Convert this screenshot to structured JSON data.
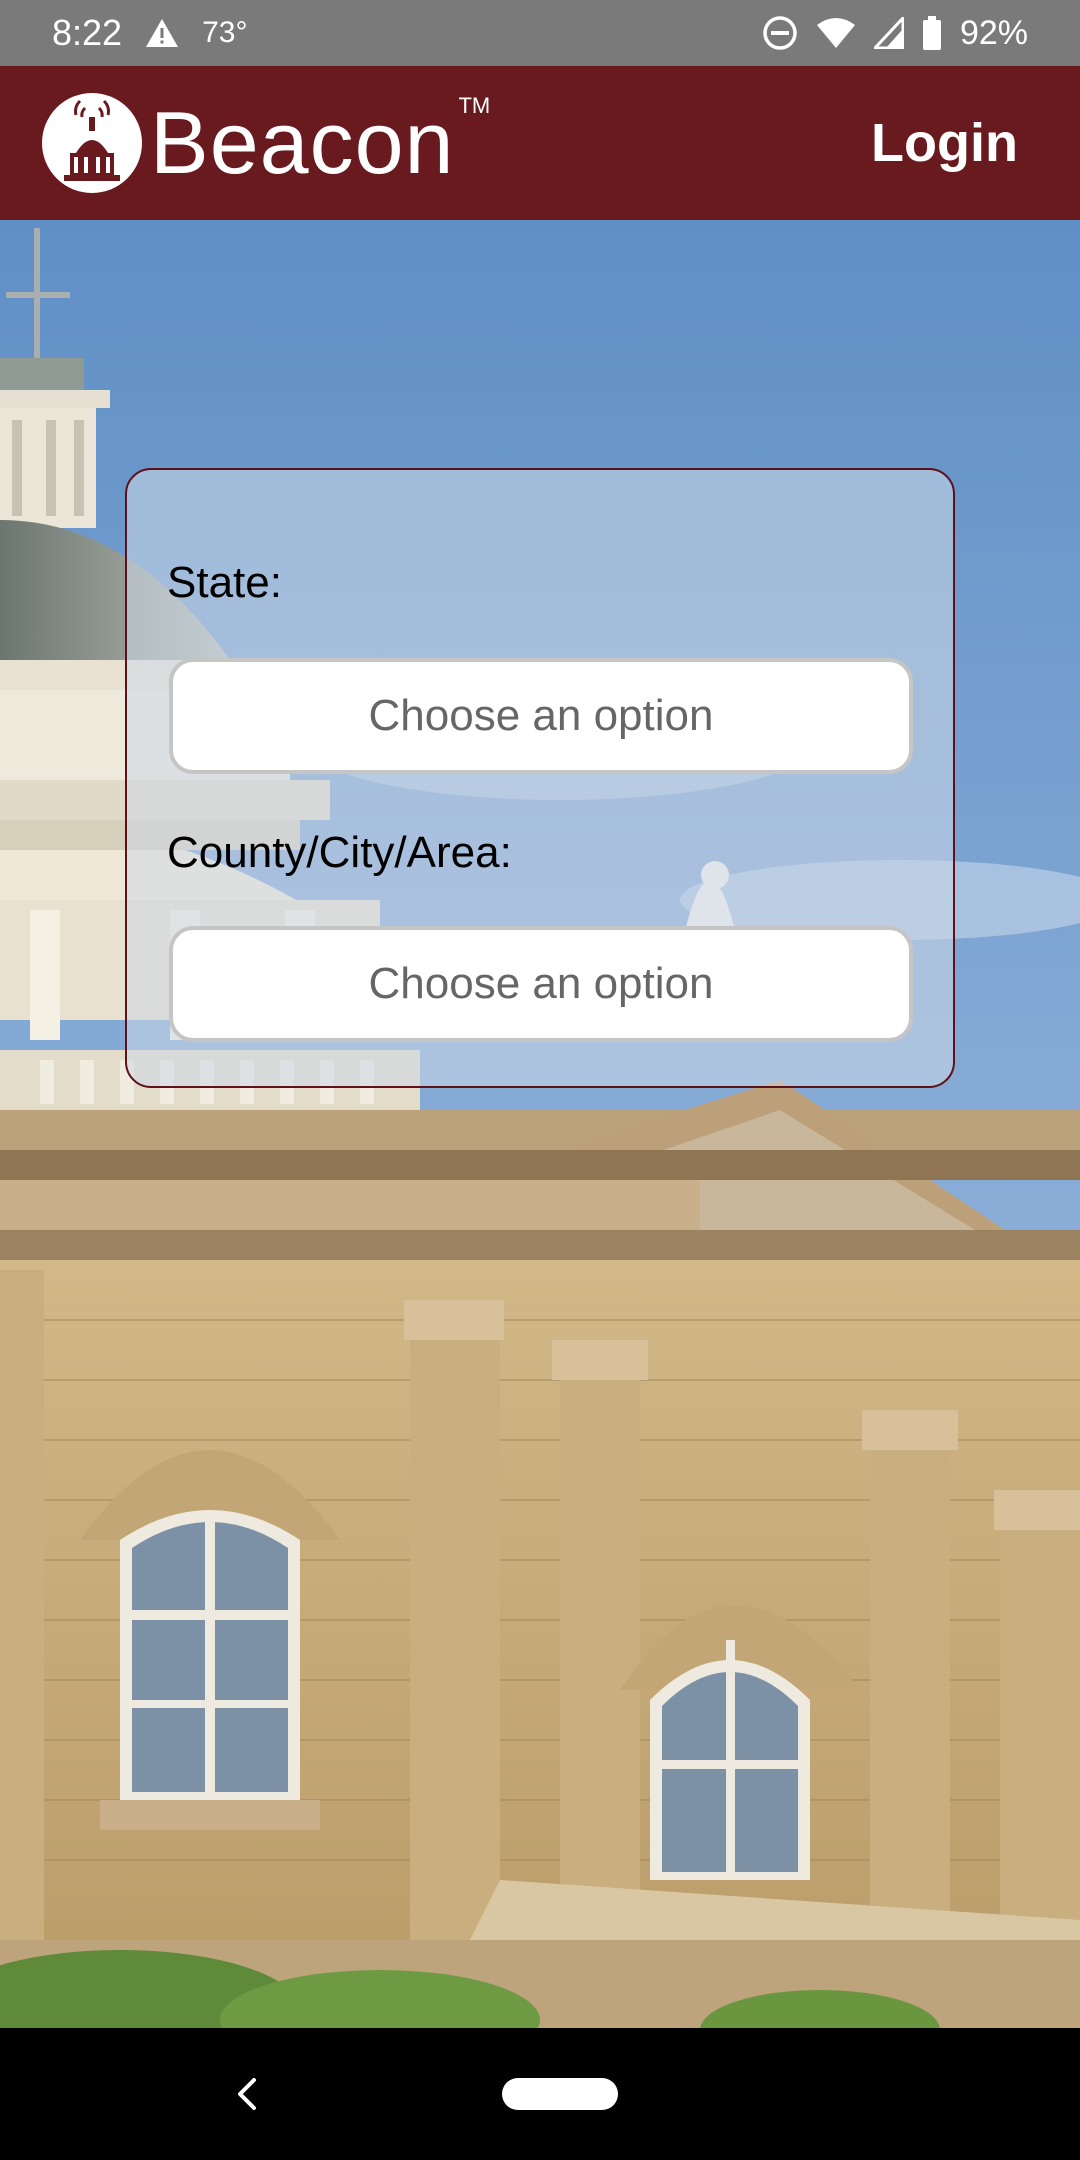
{
  "status_bar": {
    "time": "8:22",
    "temperature": "73°",
    "battery": "92%",
    "icons": [
      "warning-icon",
      "do-not-disturb-icon",
      "wifi-icon",
      "signal-icon",
      "battery-icon"
    ]
  },
  "header": {
    "brand_name": "Beacon",
    "trademark": "TM",
    "login_label": "Login",
    "background_color": "#681a1e"
  },
  "form": {
    "state_label": "State:",
    "state_placeholder": "Choose an option",
    "county_label": "County/City/Area:",
    "county_placeholder": "Choose an option"
  },
  "nav": {
    "icons": [
      "back-icon",
      "home-pill"
    ]
  }
}
